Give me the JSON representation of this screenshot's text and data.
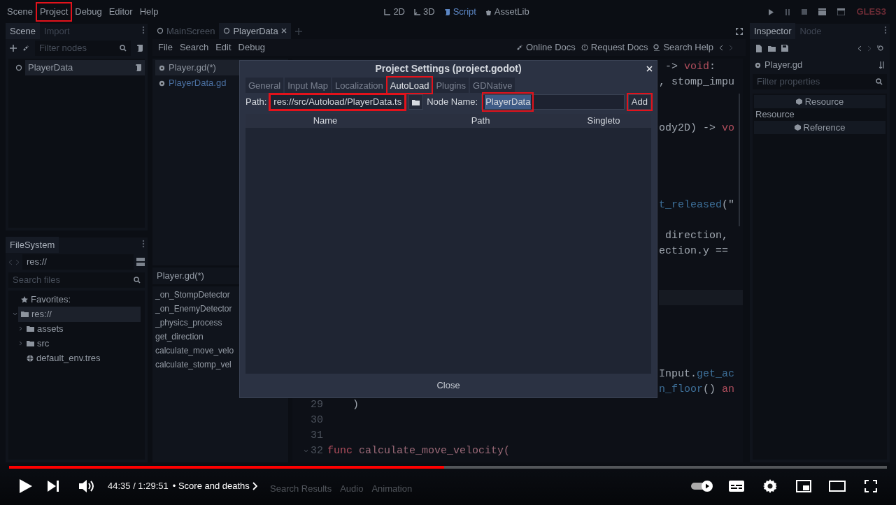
{
  "menu_bar": {
    "menus": [
      {
        "label": "Scene",
        "highlighted": false
      },
      {
        "label": "Project",
        "highlighted": true
      },
      {
        "label": "Debug",
        "highlighted": false
      },
      {
        "label": "Editor",
        "highlighted": false
      },
      {
        "label": "Help",
        "highlighted": false
      }
    ],
    "workspaces": [
      {
        "label": "2D",
        "kind": "flat",
        "selected": false
      },
      {
        "label": "3D",
        "kind": "spatial",
        "selected": false
      },
      {
        "label": "Script",
        "kind": "script",
        "selected": true
      },
      {
        "label": "AssetLib",
        "kind": "assetlib",
        "selected": false
      }
    ],
    "renderer": "GLES3"
  },
  "scene_dock": {
    "tabs": [
      {
        "label": "Scene",
        "selected": true
      },
      {
        "label": "Import",
        "selected": false
      }
    ],
    "filter": {
      "placeholder": "Filter nodes"
    },
    "nodes": [
      {
        "label": "PlayerData",
        "selected": true
      }
    ]
  },
  "filesystem_dock": {
    "tabs": [
      {
        "label": "FileSystem",
        "selected": true
      }
    ],
    "path": "res://",
    "search": {
      "placeholder": "Search files"
    },
    "tree": [
      {
        "label": "Favorites:",
        "kind": "favorites",
        "selected": false
      },
      {
        "label": "res://",
        "kind": "folder",
        "expanded": true,
        "selected": true,
        "children": [
          {
            "label": "assets",
            "kind": "folder",
            "expanded": false,
            "selected": false
          },
          {
            "label": "src",
            "kind": "folder",
            "expanded": false,
            "selected": false
          },
          {
            "label": "default_env.tres",
            "kind": "resource",
            "selected": false
          }
        ]
      }
    ]
  },
  "script_tabs": [
    {
      "label": "MainScreen",
      "selected": false,
      "closable": false
    },
    {
      "label": "PlayerData",
      "selected": true,
      "closable": true
    }
  ],
  "script_menu": [
    "File",
    "Search",
    "Edit",
    "Debug"
  ],
  "help_links": [
    {
      "label": "Online Docs",
      "kind": "docs"
    },
    {
      "label": "Request Docs",
      "kind": "request"
    },
    {
      "label": "Search Help",
      "kind": "search"
    }
  ],
  "scripts": [
    {
      "label": "Player.gd(*)",
      "selected": true
    },
    {
      "label": "PlayerData.gd",
      "selected": false
    }
  ],
  "outline": {
    "title": "Player.gd(*)",
    "methods": [
      "_on_StompDetector",
      "_on_EnemyDetector",
      "_physics_process",
      "get_direction",
      "calculate_move_velo",
      "calculate_stomp_vel"
    ]
  },
  "code_lines": [
    {
      "current": false,
      "tail": [
        {
          "text": " -> ",
          "kind": "plain"
        },
        {
          "text": "void",
          "kind": "keyword"
        },
        {
          "text": ":",
          "kind": "plain"
        }
      ]
    },
    {
      "current": false,
      "tail": [
        {
          "text": ", stomp_impu",
          "kind": "plain"
        }
      ]
    },
    {
      "current": false
    },
    {
      "current": false
    },
    {
      "current": false,
      "tail": [
        {
          "text": "ody2D) -> ",
          "kind": "plain"
        },
        {
          "text": "vo",
          "kind": "keyword"
        }
      ]
    },
    {
      "current": false
    },
    {
      "current": false
    },
    {
      "current": false
    },
    {
      "current": false
    },
    {
      "current": false,
      "tail": [
        {
          "text": "t_released",
          "kind": "call"
        },
        {
          "text": "(\"",
          "kind": "plain"
        }
      ]
    },
    {
      "current": false
    },
    {
      "current": false,
      "tail": [
        {
          "text": " direction,",
          "kind": "plain"
        }
      ]
    },
    {
      "current": false,
      "tail": [
        {
          "text": "ection.y ==",
          "kind": "plain"
        }
      ]
    },
    {
      "current": false
    },
    {
      "current": false
    },
    {
      "current": true
    },
    {
      "current": false
    },
    {
      "current": false
    },
    {
      "current": false
    },
    {
      "current": false
    },
    {
      "current": false,
      "tail": [
        {
          "text": "Input.",
          "kind": "plain"
        },
        {
          "text": "get_ac",
          "kind": "call"
        }
      ]
    },
    {
      "current": false,
      "tail": [
        {
          "text": "n_floor",
          "kind": "call"
        },
        {
          "text": "() ",
          "kind": "plain"
        },
        {
          "text": "an",
          "kind": "keyword"
        }
      ]
    },
    {
      "current": false,
      "number": "29",
      "tokens": [
        {
          "text": "    )",
          "kind": "plain"
        }
      ]
    },
    {
      "current": false,
      "number": "30"
    },
    {
      "current": false,
      "number": "31"
    },
    {
      "current": false,
      "number": "32",
      "foldable": true,
      "tokens": [
        {
          "text": "func",
          "kind": "keyword"
        },
        {
          "text": " calculate_move_velocity(",
          "kind": "function"
        }
      ]
    }
  ],
  "inspector": {
    "tabs": [
      {
        "label": "Inspector",
        "selected": true
      },
      {
        "label": "Node",
        "selected": false
      }
    ],
    "resource": "Player.gd",
    "filter": {
      "placeholder": "Filter properties"
    },
    "sections": [
      {
        "kind": "header",
        "label": "Resource"
      },
      {
        "kind": "property",
        "label": "Resource"
      },
      {
        "kind": "header",
        "label": "Reference"
      }
    ]
  },
  "bottom_panel": [
    "Search Results",
    "Audio",
    "Animation"
  ],
  "dialog": {
    "title": "Project Settings (project.godot)",
    "tabs": [
      {
        "label": "General",
        "selected": false,
        "highlighted": false
      },
      {
        "label": "Input Map",
        "selected": false,
        "highlighted": false
      },
      {
        "label": "Localization",
        "selected": false,
        "highlighted": false
      },
      {
        "label": "AutoLoad",
        "selected": true,
        "highlighted": true
      },
      {
        "label": "Plugins",
        "selected": false,
        "highlighted": false
      },
      {
        "label": "GDNative",
        "selected": false,
        "highlighted": false
      }
    ],
    "path_label": "Path:",
    "path": {
      "value": "res://src/Autoload/PlayerData.ts",
      "highlighted": true
    },
    "node_name_label": "Node Name:",
    "node_name": {
      "value": "PlayerData",
      "highlighted": true,
      "text_selected": true
    },
    "add_button": {
      "label": "Add",
      "highlighted": true
    },
    "columns": [
      "Name",
      "Path",
      "Singleto"
    ],
    "close_button": "Close"
  },
  "player": {
    "level": 0.496,
    "time": "44:35 / 1:29:51",
    "separator": "•",
    "chapter": "Score and deaths",
    "autoplay": true
  }
}
